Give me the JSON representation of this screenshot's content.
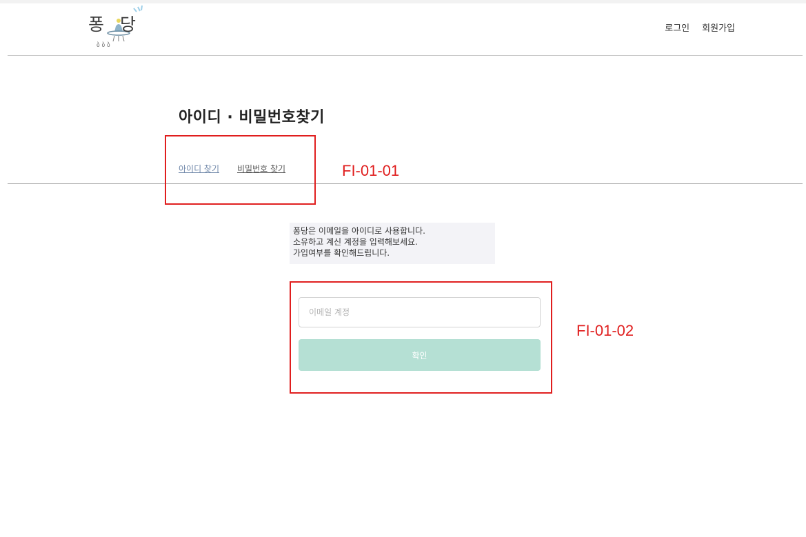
{
  "header": {
    "logo_text_1": "퐁",
    "logo_text_2": "당",
    "nav": {
      "login": "로그인",
      "signup": "회원가입"
    }
  },
  "page": {
    "title": "아이디 · 비밀번호찾기"
  },
  "tabs": [
    {
      "label": "아이디 찾기",
      "active": true
    },
    {
      "label": "비밀번호 찾기",
      "active": false
    }
  ],
  "info": {
    "lines": [
      "퐁당은 이메일을 아이디로 사용합니다.",
      "소유하고 계신 계정을 입력해보세요.",
      "가입여부를 확인해드립니다."
    ]
  },
  "form": {
    "email_placeholder": "이메일 계정",
    "email_value": "",
    "confirm_label": "확인"
  },
  "annotations": {
    "label_1": "FI-01-01",
    "label_2": "FI-01-02"
  },
  "colors": {
    "accent_button": "#b5e0d4",
    "active_tab": "#6e86a8",
    "annotation": "#e01e1e"
  }
}
